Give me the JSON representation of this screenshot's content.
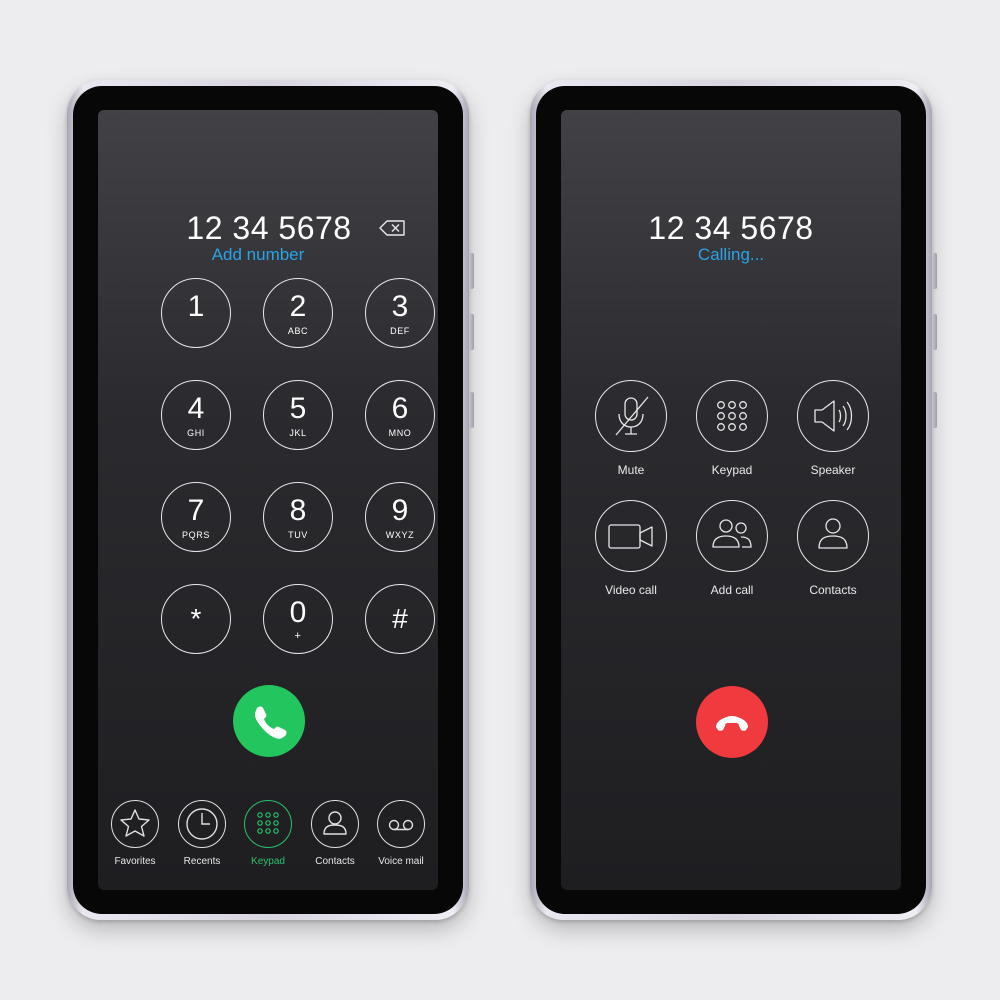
{
  "dialer": {
    "number": "12 34 5678",
    "add_number": "Add number",
    "keys": [
      {
        "digit": "1",
        "letters": ""
      },
      {
        "digit": "2",
        "letters": "ABC"
      },
      {
        "digit": "3",
        "letters": "DEF"
      },
      {
        "digit": "4",
        "letters": "GHI"
      },
      {
        "digit": "5",
        "letters": "JKL"
      },
      {
        "digit": "6",
        "letters": "MNO"
      },
      {
        "digit": "7",
        "letters": "PQRS"
      },
      {
        "digit": "8",
        "letters": "TUV"
      },
      {
        "digit": "9",
        "letters": "WXYZ"
      },
      {
        "digit": "*",
        "letters": ""
      },
      {
        "digit": "0",
        "letters": "+"
      },
      {
        "digit": "#",
        "letters": ""
      }
    ],
    "nav": [
      {
        "label": "Favorites",
        "icon": "star-icon"
      },
      {
        "label": "Recents",
        "icon": "clock-icon"
      },
      {
        "label": "Keypad",
        "icon": "keypad-icon",
        "active": true
      },
      {
        "label": "Contacts",
        "icon": "person-icon"
      },
      {
        "label": "Voice mail",
        "icon": "voicemail-icon"
      }
    ],
    "call_color": "#22c55e",
    "active_color": "#27c26a"
  },
  "in_call": {
    "number": "12 34 5678",
    "status": "Calling...",
    "actions": [
      {
        "label": "Mute",
        "icon": "mic-off-icon"
      },
      {
        "label": "Keypad",
        "icon": "keypad-icon"
      },
      {
        "label": "Speaker",
        "icon": "speaker-icon"
      },
      {
        "label": "Video call",
        "icon": "video-camera-icon"
      },
      {
        "label": "Add call",
        "icon": "add-people-icon"
      },
      {
        "label": "Contacts",
        "icon": "person-icon"
      }
    ],
    "end_color": "#f03a3e",
    "status_color": "#2aa3e6"
  }
}
